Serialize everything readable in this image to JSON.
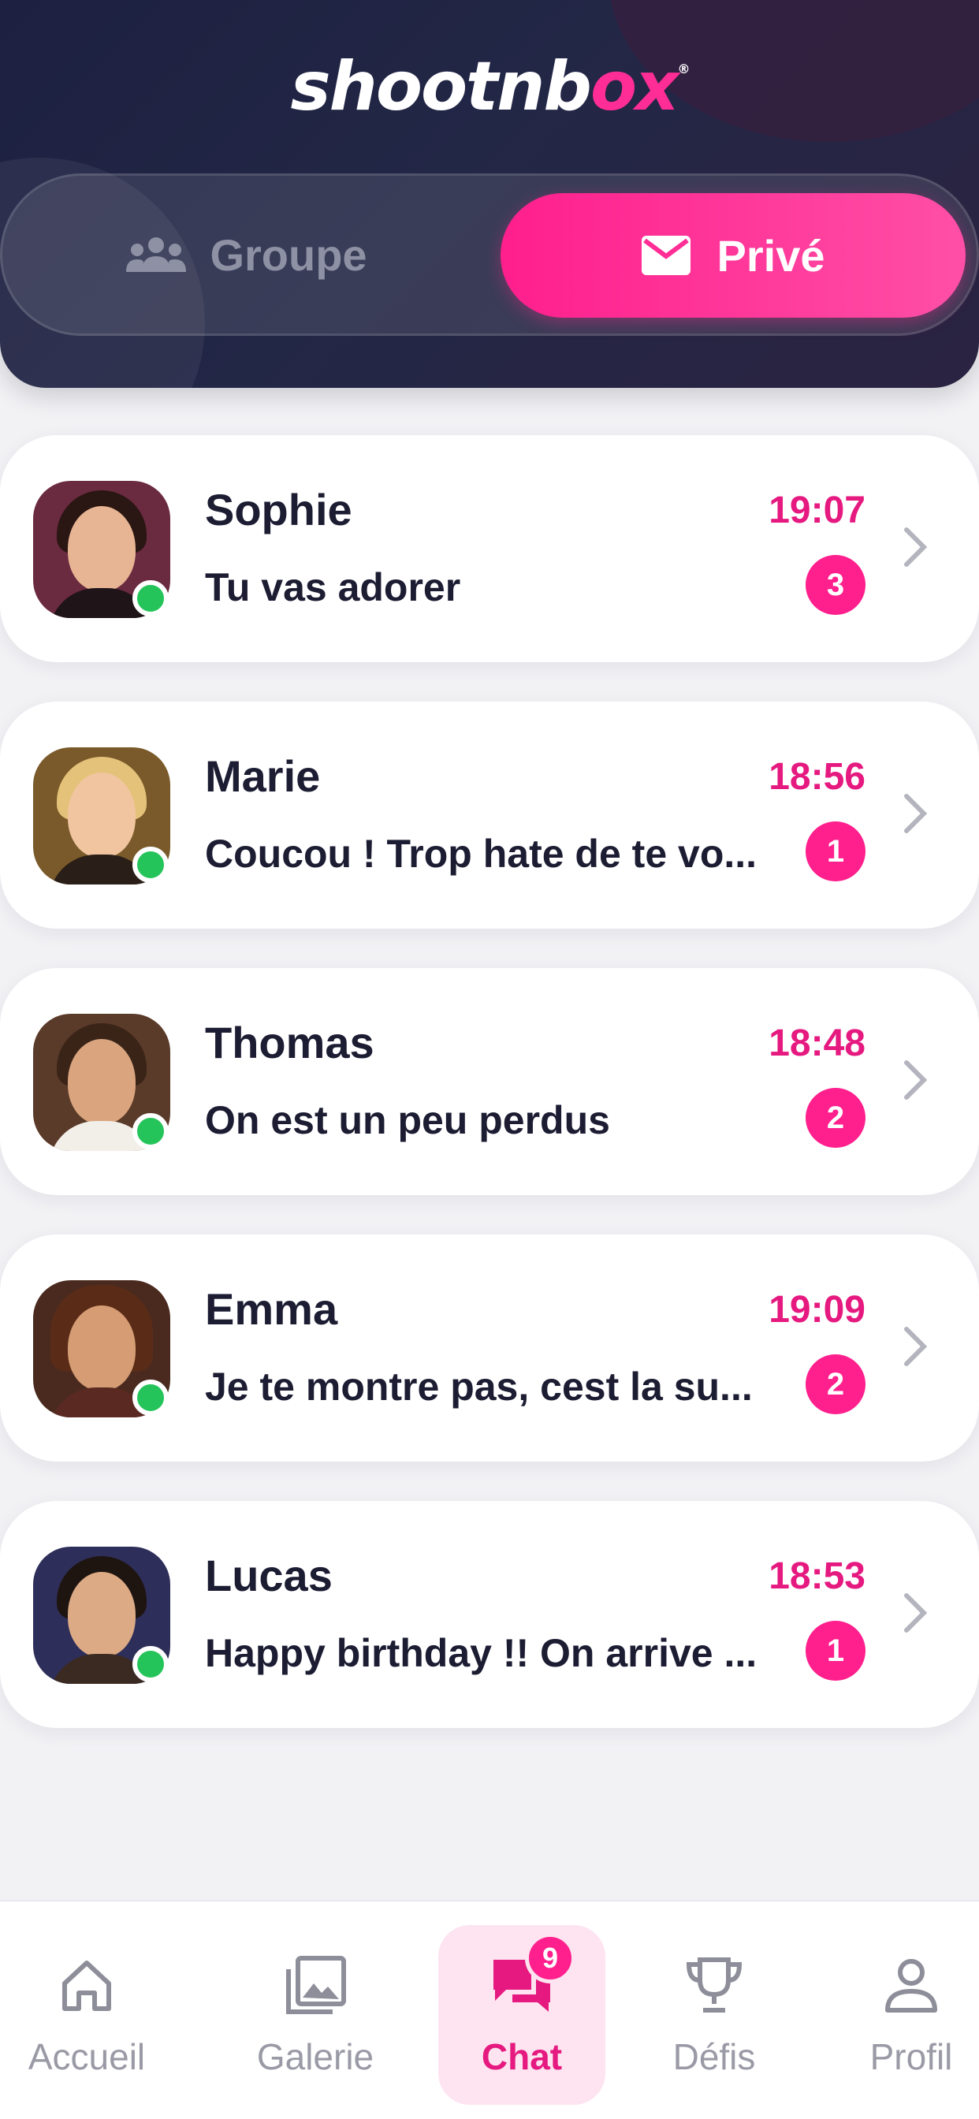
{
  "header": {
    "logo": {
      "part1": "shootnb",
      "part2": "ox",
      "mark": "®"
    },
    "tabs": [
      {
        "label": "Groupe",
        "icon": "group-icon",
        "active": false
      },
      {
        "label": "Privé",
        "icon": "mail-icon",
        "active": true
      }
    ]
  },
  "conversations": [
    {
      "name": "Sophie",
      "time": "19:07",
      "message": "Tu vas adorer",
      "unread": "3",
      "online": true
    },
    {
      "name": "Marie",
      "time": "18:56",
      "message": "Coucou ! Trop hate de te vo...",
      "unread": "1",
      "online": true
    },
    {
      "name": "Thomas",
      "time": "18:48",
      "message": "On est un peu perdus",
      "unread": "2",
      "online": true
    },
    {
      "name": "Emma",
      "time": "19:09",
      "message": "Je te montre pas, cest la su...",
      "unread": "2",
      "online": true
    },
    {
      "name": "Lucas",
      "time": "18:53",
      "message": "Happy birthday !! On arrive ...",
      "unread": "1",
      "online": true
    }
  ],
  "nav": {
    "items": [
      {
        "label": "Accueil",
        "icon": "home-icon",
        "active": false
      },
      {
        "label": "Galerie",
        "icon": "gallery-icon",
        "active": false
      },
      {
        "label": "Chat",
        "icon": "chat-icon",
        "active": true,
        "badge": "9"
      },
      {
        "label": "Défis",
        "icon": "trophy-icon",
        "active": false
      },
      {
        "label": "Profil",
        "icon": "profile-icon",
        "active": false
      }
    ]
  },
  "colors": {
    "accent": "#ff1f8d",
    "header_bg": "#1d2040",
    "online": "#25c45a",
    "time": "#e5197f"
  }
}
